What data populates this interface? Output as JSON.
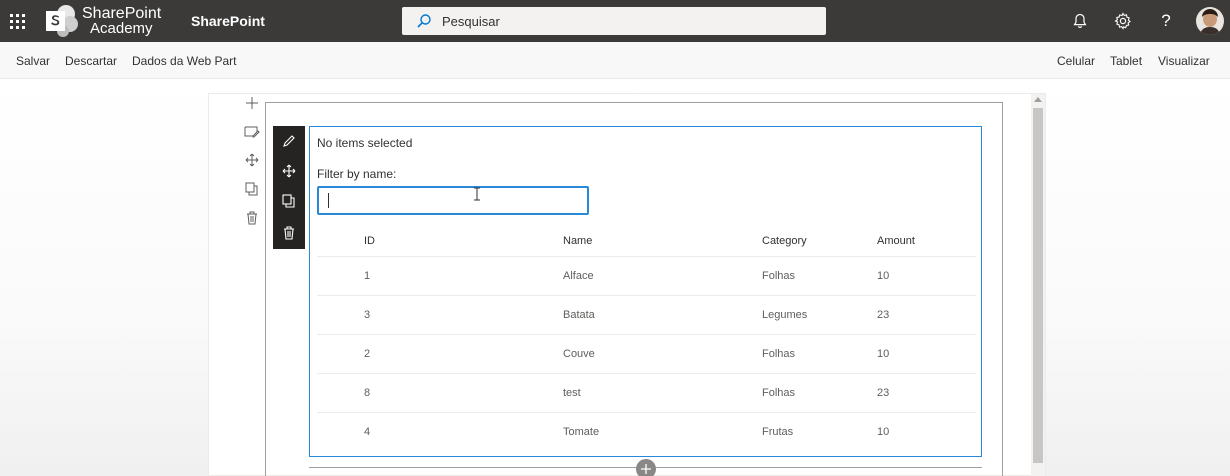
{
  "suite_bar": {
    "logo_line1": "SharePoint",
    "logo_line2": "Academy",
    "site_name": "SharePoint",
    "search_placeholder": "Pesquisar",
    "accent_color": "#3b3a39",
    "icons": [
      "app-launcher-icon",
      "bell-icon",
      "gear-icon",
      "help-icon",
      "avatar"
    ]
  },
  "command_bar": {
    "left": [
      "Salvar",
      "Descartar",
      "Dados da Web Part"
    ],
    "right": [
      "Celular",
      "Tablet",
      "Visualizar"
    ]
  },
  "section_toolbar": [
    "add-icon",
    "edit-section-icon",
    "move-icon",
    "duplicate-icon",
    "delete-icon"
  ],
  "webpart_toolbar": [
    "edit-icon",
    "move-icon",
    "duplicate-icon",
    "delete-icon"
  ],
  "webpart": {
    "selection_status": "No items selected",
    "filter_label": "Filter by name:",
    "filter_value": "",
    "columns": [
      "ID",
      "Name",
      "Category",
      "Amount"
    ],
    "rows": [
      {
        "id": "1",
        "name": "Alface",
        "category": "Folhas",
        "amount": "10"
      },
      {
        "id": "3",
        "name": "Batata",
        "category": "Legumes",
        "amount": "23"
      },
      {
        "id": "2",
        "name": "Couve",
        "category": "Folhas",
        "amount": "10"
      },
      {
        "id": "8",
        "name": "test",
        "category": "Folhas",
        "amount": "23"
      },
      {
        "id": "4",
        "name": "Tomate",
        "category": "Frutas",
        "amount": "10"
      }
    ],
    "border_color": "#2b88d8"
  }
}
